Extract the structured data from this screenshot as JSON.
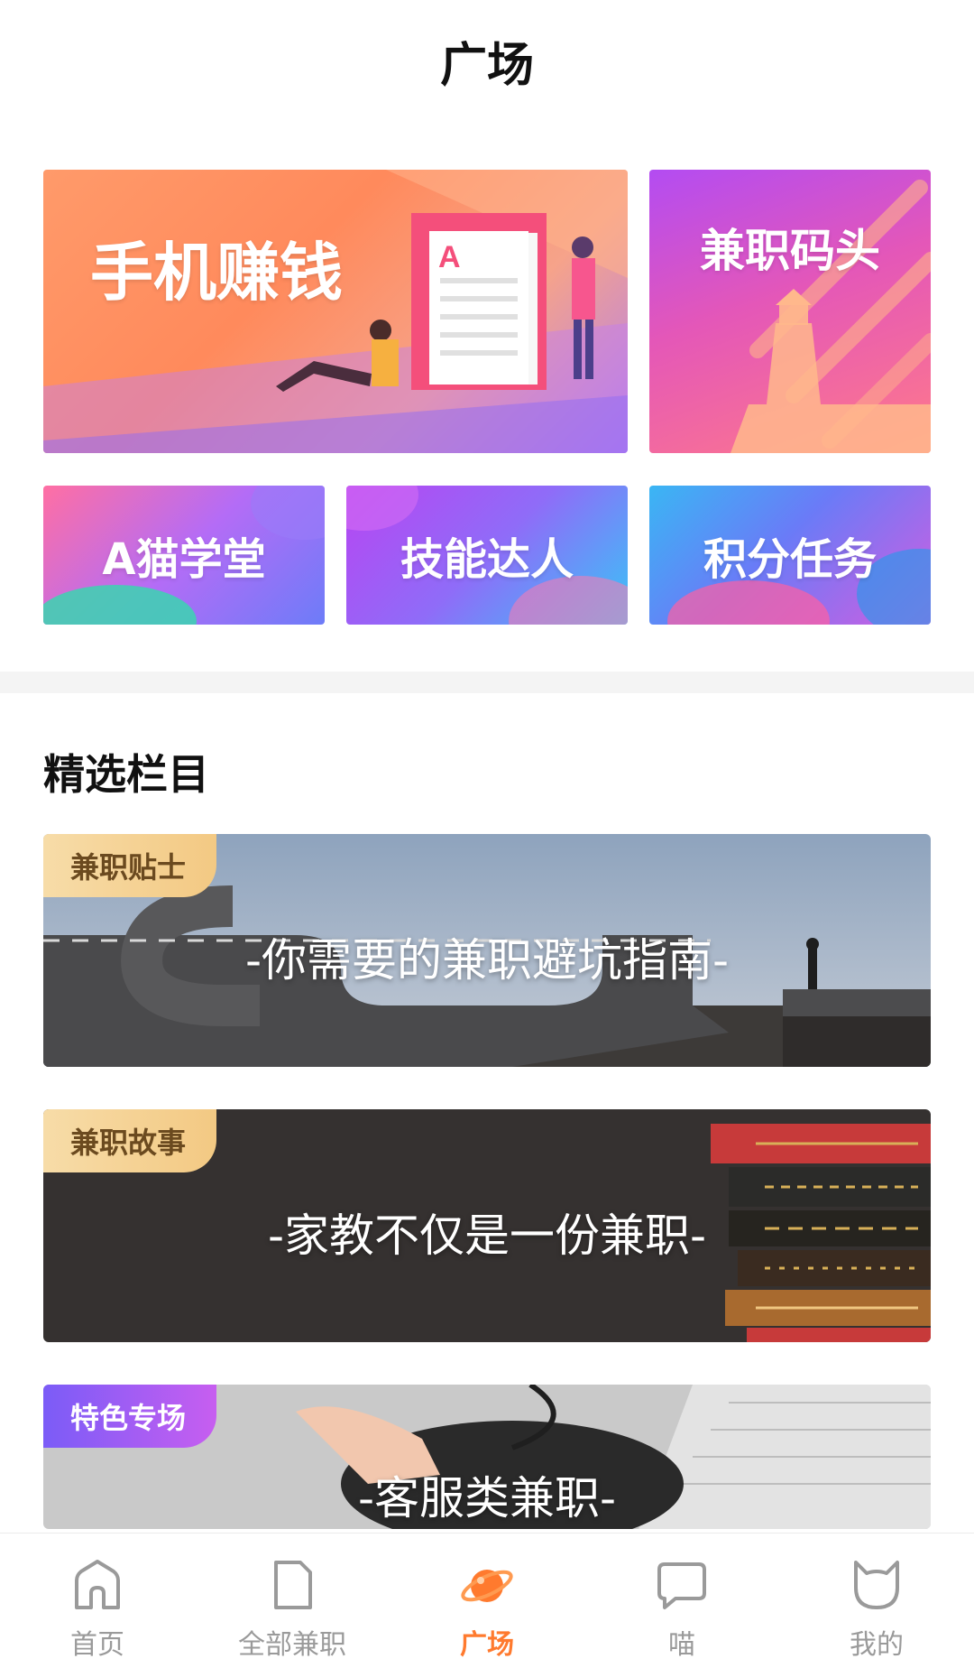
{
  "header": {
    "title": "广场"
  },
  "tiles": {
    "earn": "手机赚钱",
    "dock": "兼职码头",
    "school": "A猫学堂",
    "skill": "技能达人",
    "points": "积分任务"
  },
  "section": {
    "title": "精选栏目"
  },
  "banners": [
    {
      "tag": "兼职贴士",
      "caption": "-你需要的兼职避坑指南-"
    },
    {
      "tag": "兼职故事",
      "caption": "-家教不仅是一份兼职-"
    },
    {
      "tag": "特色专场",
      "caption": "-客服类兼职-"
    }
  ],
  "tabbar": {
    "items": [
      {
        "label": "首页",
        "icon": "home-icon"
      },
      {
        "label": "全部兼职",
        "icon": "document-icon"
      },
      {
        "label": "广场",
        "icon": "planet-icon"
      },
      {
        "label": "喵",
        "icon": "chat-bubble-icon"
      },
      {
        "label": "我的",
        "icon": "cat-face-icon"
      }
    ],
    "active_index": 2,
    "active_color": "#ff7a2e",
    "inactive_color": "#9a9a9a"
  }
}
